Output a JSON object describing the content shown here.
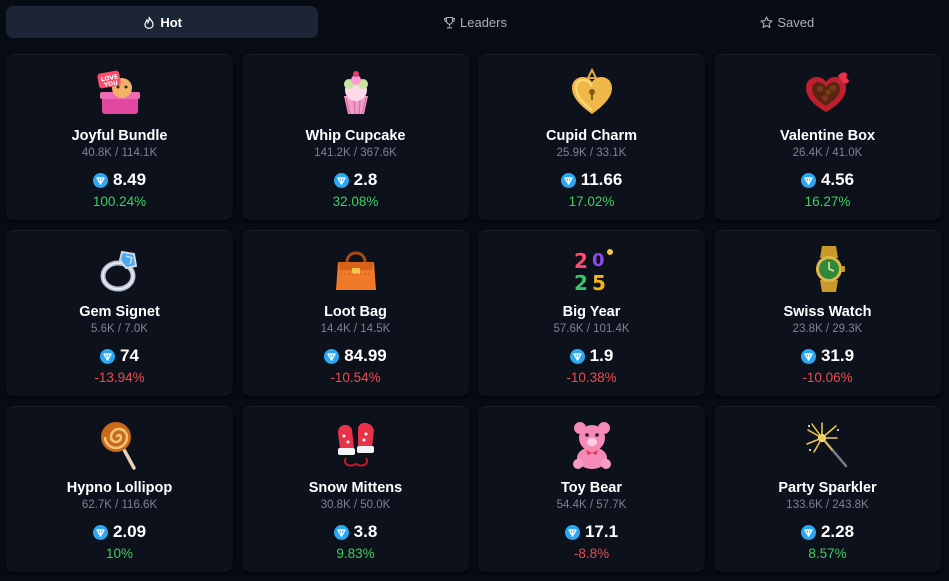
{
  "tabs": [
    {
      "label": "Hot",
      "icon": "fire-icon",
      "active": true
    },
    {
      "label": "Leaders",
      "icon": "trophy-icon",
      "active": false
    },
    {
      "label": "Saved",
      "icon": "star-icon",
      "active": false
    }
  ],
  "colors": {
    "positive": "#3fcf5e",
    "negative": "#f04a4a",
    "ton": "#2aa8f2"
  },
  "cards": [
    {
      "name": "Joyful Bundle",
      "supply": "40.8K / 114.1K",
      "price": "8.49",
      "change": "100.24%",
      "trend": "up",
      "icon": "love-you-gift-icon"
    },
    {
      "name": "Whip Cupcake",
      "supply": "141.2K / 367.6K",
      "price": "2.8",
      "change": "32.08%",
      "trend": "up",
      "icon": "cupcake-icon"
    },
    {
      "name": "Cupid Charm",
      "supply": "25.9K / 33.1K",
      "price": "11.66",
      "change": "17.02%",
      "trend": "up",
      "icon": "heart-locket-icon"
    },
    {
      "name": "Valentine Box",
      "supply": "26.4K / 41.0K",
      "price": "4.56",
      "change": "16.27%",
      "trend": "up",
      "icon": "chocolate-box-icon"
    },
    {
      "name": "Gem Signet",
      "supply": "5.6K / 7.0K",
      "price": "74",
      "change": "-13.94%",
      "trend": "down",
      "icon": "ring-icon"
    },
    {
      "name": "Loot Bag",
      "supply": "14.4K / 14.5K",
      "price": "84.99",
      "change": "-10.54%",
      "trend": "down",
      "icon": "handbag-icon"
    },
    {
      "name": "Big Year",
      "supply": "57.6K / 101.4K",
      "price": "1.9",
      "change": "-10.38%",
      "trend": "down",
      "icon": "2025-icon"
    },
    {
      "name": "Swiss Watch",
      "supply": "23.8K / 29.3K",
      "price": "31.9",
      "change": "-10.06%",
      "trend": "down",
      "icon": "watch-icon"
    },
    {
      "name": "Hypno Lollipop",
      "supply": "62.7K / 116.6K",
      "price": "2.09",
      "change": "10%",
      "trend": "up",
      "icon": "lollipop-icon"
    },
    {
      "name": "Snow Mittens",
      "supply": "30.8K / 50.0K",
      "price": "3.8",
      "change": "9.83%",
      "trend": "up",
      "icon": "mittens-icon"
    },
    {
      "name": "Toy Bear",
      "supply": "54.4K / 57.7K",
      "price": "17.1",
      "change": "-8.8%",
      "trend": "down",
      "icon": "teddy-bear-icon"
    },
    {
      "name": "Party Sparkler",
      "supply": "133.6K / 243.8K",
      "price": "2.28",
      "change": "8.57%",
      "trend": "up",
      "icon": "sparkler-icon"
    }
  ]
}
